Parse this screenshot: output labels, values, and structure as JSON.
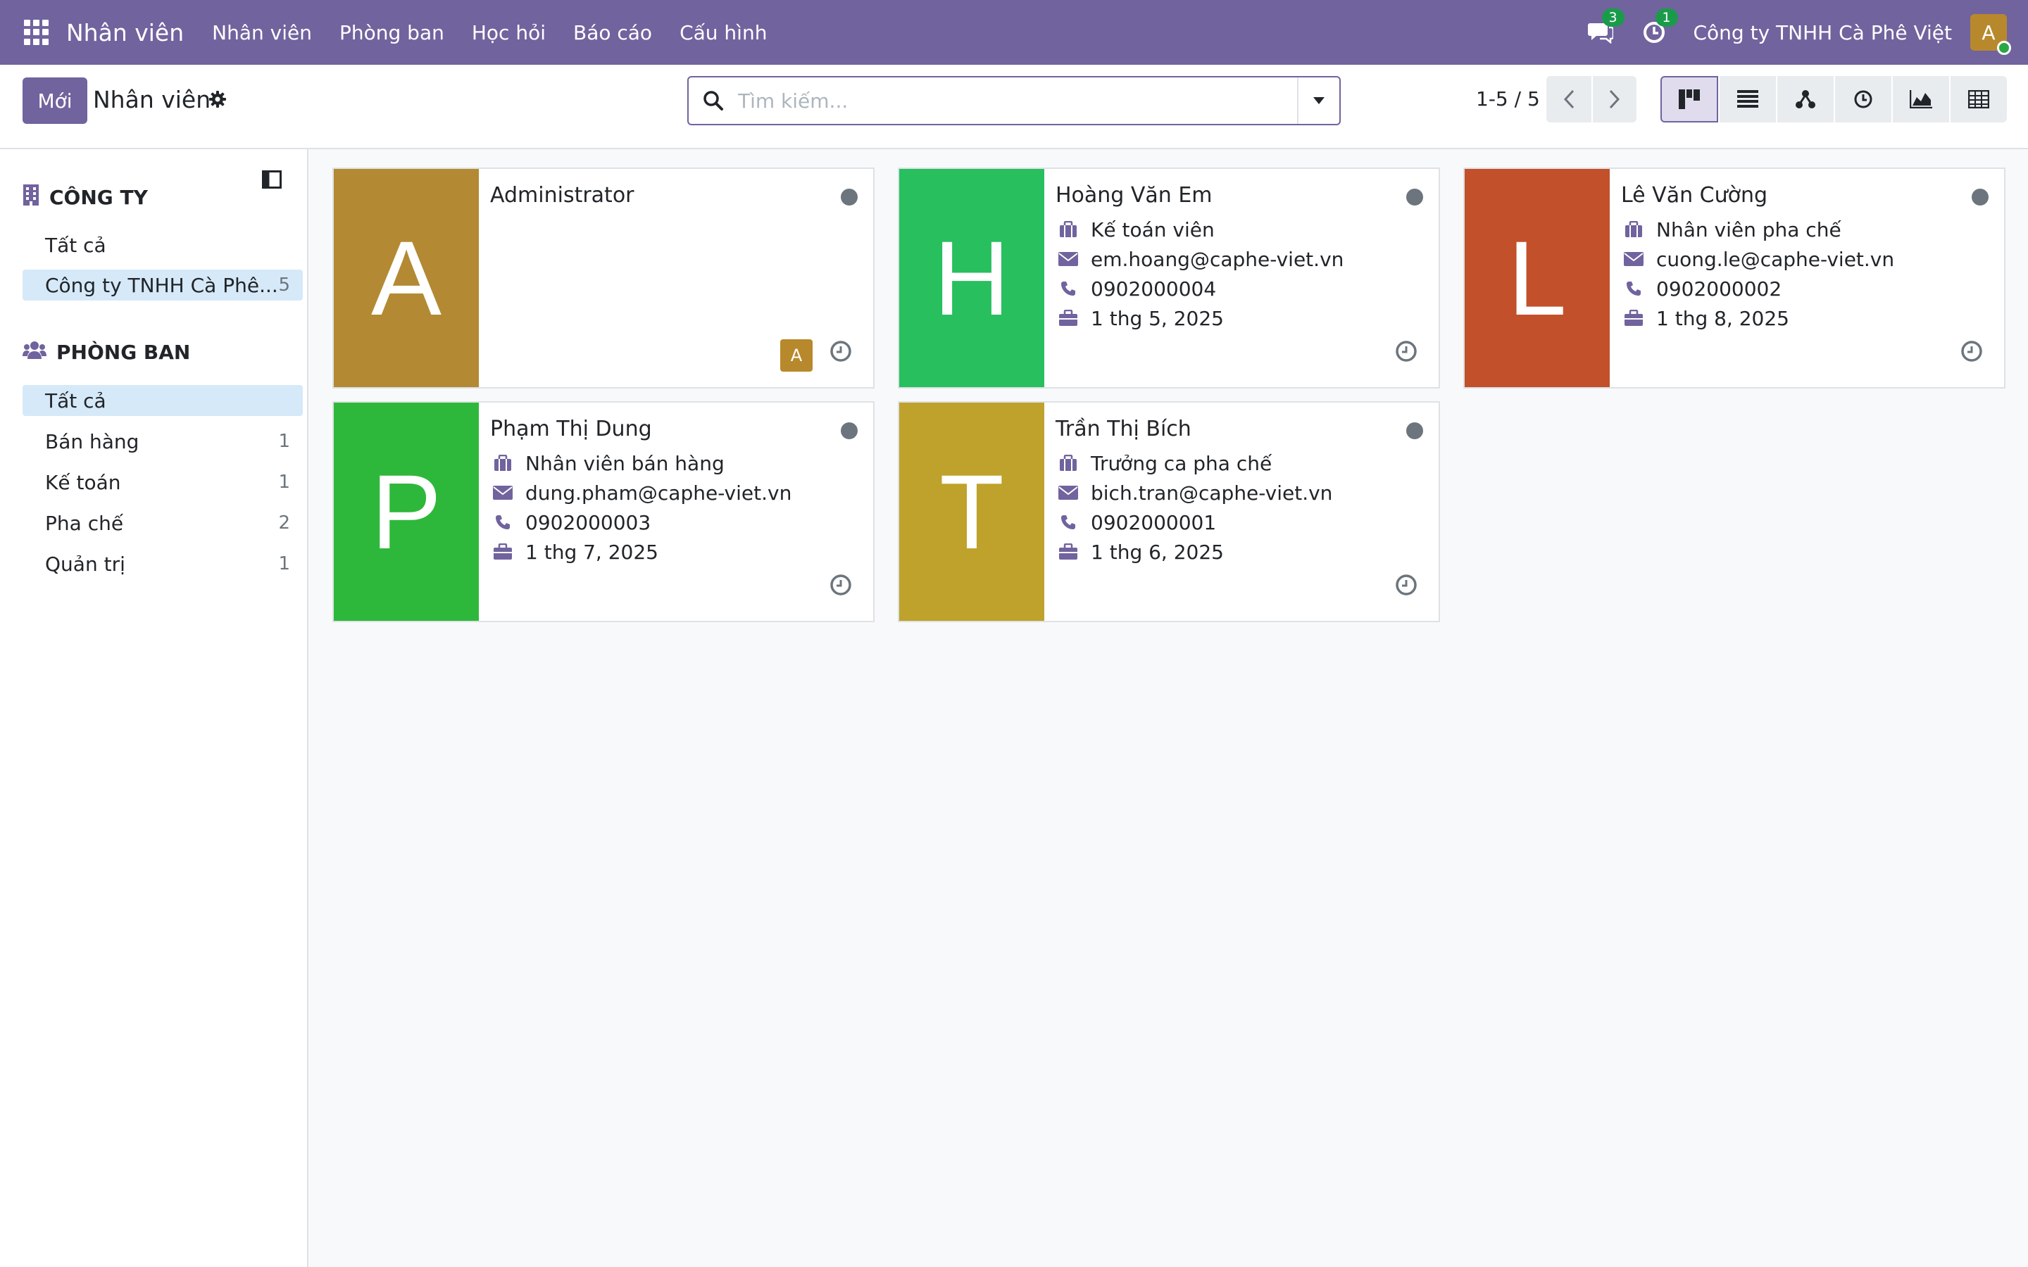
{
  "navbar": {
    "app_name": "Nhân viên",
    "menu": [
      "Nhân viên",
      "Phòng ban",
      "Học hỏi",
      "Báo cáo",
      "Cấu hình"
    ],
    "messages_count": "3",
    "activities_count": "1",
    "company": "Công ty TNHH Cà Phê Việt",
    "user_initial": "A"
  },
  "control": {
    "new_label": "Mới",
    "title": "Nhân viên",
    "search_placeholder": "Tìm kiếm...",
    "pager": "1-5 / 5"
  },
  "sidebar": {
    "company_section": "CÔNG TY",
    "company_items": [
      {
        "label": "Tất cả",
        "count": ""
      },
      {
        "label": "Công ty TNHH Cà Phê...",
        "count": "5"
      }
    ],
    "department_section": "PHÒNG BAN",
    "department_items": [
      {
        "label": "Tất cả",
        "count": ""
      },
      {
        "label": "Bán hàng",
        "count": "1"
      },
      {
        "label": "Kế toán",
        "count": "1"
      },
      {
        "label": "Pha chế",
        "count": "2"
      },
      {
        "label": "Quản trị",
        "count": "1"
      }
    ]
  },
  "employees": [
    {
      "initial": "A",
      "name": "Administrator",
      "color": "#b38a33",
      "job": "",
      "email": "",
      "phone": "",
      "date": "",
      "user_initial": "A"
    },
    {
      "initial": "H",
      "name": "Hoàng Văn Em",
      "color": "#28bf5f",
      "job": "Kế toán viên",
      "email": "em.hoang@caphe-viet.vn",
      "phone": "0902000004",
      "date": "1 thg 5, 2025"
    },
    {
      "initial": "L",
      "name": "Lê Văn Cường",
      "color": "#c2502a",
      "job": "Nhân viên pha chế",
      "email": "cuong.le@caphe-viet.vn",
      "phone": "0902000002",
      "date": "1 thg 8, 2025"
    },
    {
      "initial": "P",
      "name": "Phạm Thị Dung",
      "color": "#2eb83b",
      "job": "Nhân viên bán hàng",
      "email": "dung.pham@caphe-viet.vn",
      "phone": "0902000003",
      "date": "1 thg 7, 2025"
    },
    {
      "initial": "T",
      "name": "Trần Thị Bích",
      "color": "#bea22b",
      "job": "Trưởng ca pha chế",
      "email": "bich.tran@caphe-viet.vn",
      "phone": "0902000001",
      "date": "1 thg 6, 2025"
    }
  ]
}
